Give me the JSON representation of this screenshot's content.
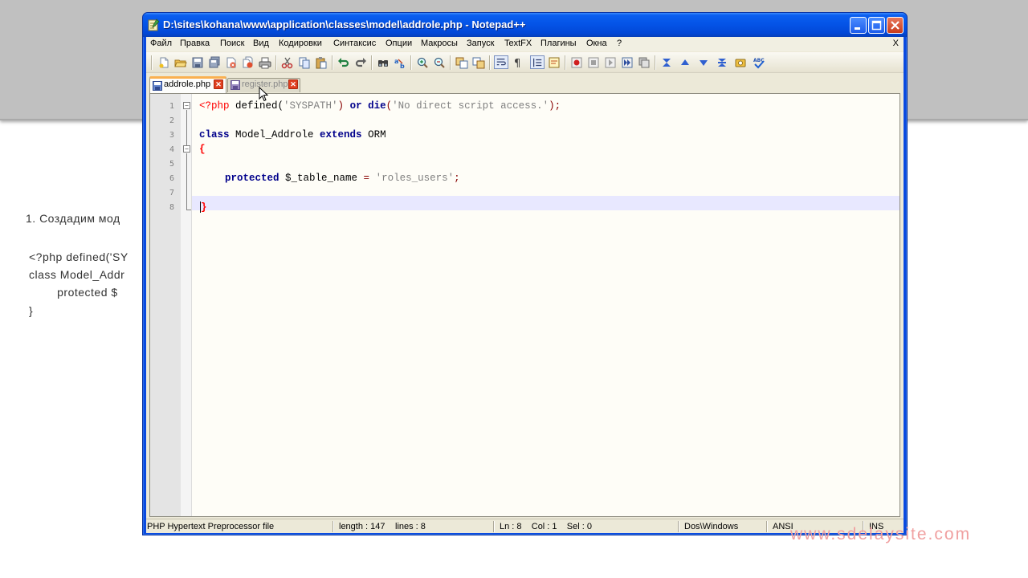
{
  "background": {
    "text_lines": [
      "1. Создадим мод",
      "<?php defined('SY",
      "class Model_Addr",
      "        protected $",
      "}"
    ],
    "watermark": "www.sdelaysite.com"
  },
  "window": {
    "title": "D:\\sites\\kohana\\www\\application\\classes\\model\\addrole.php - Notepad++",
    "colors": {
      "titlebar": "#0453e6",
      "accent_tab": "#fab050"
    }
  },
  "menu": {
    "items": [
      "Файл",
      "Правка",
      "Поиск",
      "Вид",
      "Кодировки",
      "Синтаксис",
      "Опции",
      "Макросы",
      "Запуск",
      "TextFX",
      "Плагины",
      "Окна",
      "?"
    ],
    "close_doc": "X"
  },
  "toolbar": {
    "icons": [
      "new-file-icon",
      "open-file-icon",
      "save-icon",
      "save-all-icon",
      "close-icon",
      "close-all-icon",
      "print-icon",
      "cut-icon",
      "copy-icon",
      "paste-icon",
      "undo-icon",
      "redo-icon",
      "find-icon",
      "replace-icon",
      "zoom-in-icon",
      "zoom-out-icon",
      "sync-vertical-icon",
      "sync-horizontal-icon",
      "word-wrap-icon",
      "show-all-chars-icon",
      "indent-guide-icon",
      "user-language-icon",
      "record-macro-icon",
      "stop-record-icon",
      "playback-macro-icon",
      "run-macro-multiple-icon",
      "save-macro-icon",
      "textfx-icon-1",
      "textfx-icon-2",
      "textfx-icon-3",
      "textfx-icon-4",
      "textfx-icon-5",
      "spellcheck-icon"
    ]
  },
  "tabs": [
    {
      "label": "addrole.php",
      "active": true
    },
    {
      "label": "register.php",
      "active": false
    }
  ],
  "editor": {
    "line_numbers": [
      "1",
      "2",
      "3",
      "4",
      "5",
      "6",
      "7",
      "8"
    ],
    "lines": {
      "l1_open": "<?php",
      "l1_func": " defined(",
      "l1_arg": "'SYSPATH'",
      "l1_mid": ") ",
      "l1_or": "or",
      "l1_sp": " ",
      "l1_die": "die",
      "l1_paren": "(",
      "l1_msg": "'No direct script access.'",
      "l1_end": ");",
      "l3_class": "class",
      "l3_name": " Model_Addrole ",
      "l3_extends": "extends",
      "l3_orm": " ORM",
      "l4_brace": "{",
      "l6_protected": "protected",
      "l6_var": " $_table_name ",
      "l6_eq": "=",
      "l6_sp": " ",
      "l6_val": "'roles_users'",
      "l6_semi": ";",
      "l8_brace": "}"
    }
  },
  "status": {
    "file_type": "PHP Hypertext Preprocessor file",
    "length": "length : 147",
    "lines": "lines : 8",
    "position": "Ln : 8    Col : 1    Sel : 0",
    "eol": "Dos\\Windows",
    "encoding": "ANSI",
    "mode": "INS"
  }
}
